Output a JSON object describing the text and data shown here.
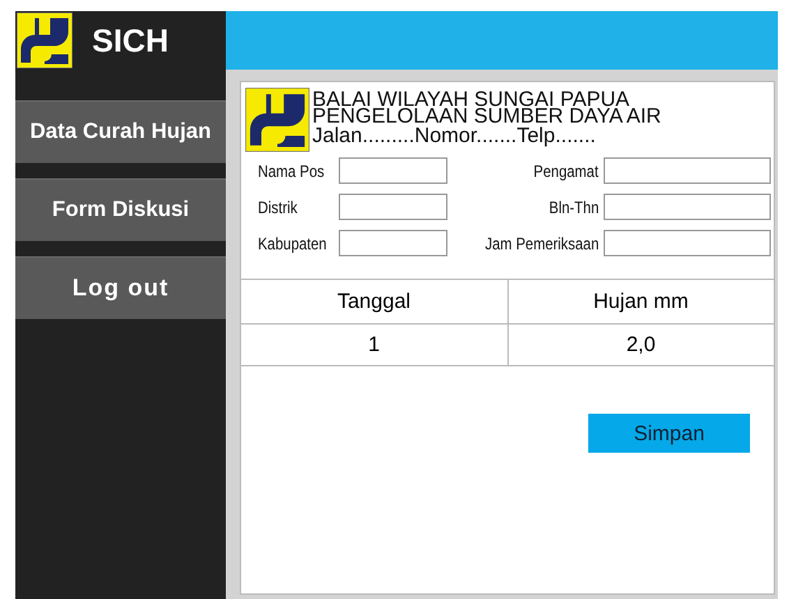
{
  "app": {
    "title": "SICH"
  },
  "sidebar": {
    "items": [
      {
        "label": "Data Curah Hujan",
        "selected": false
      },
      {
        "label": "Form Diskusi",
        "selected": false
      },
      {
        "label": "Log out",
        "selected": false
      }
    ]
  },
  "header": {
    "lines": [
      "BALAI WILAYAH SUNGAI PAPUA",
      "PENGELOLAAN SUMBER DAYA AIR",
      "Jalan.........Nomor.......Telp......."
    ]
  },
  "form": {
    "fields": [
      {
        "label": "Nama Pos"
      },
      {
        "label": "Pengamat"
      },
      {
        "label": "Distrik"
      },
      {
        "label": "Bln-Thn"
      },
      {
        "label": "Kabupaten"
      },
      {
        "label": "Jam Pemeriksaan"
      }
    ]
  },
  "table": {
    "columns": [
      "Tanggal",
      "Hujan mm"
    ],
    "rows": [
      [
        "1",
        "2,0"
      ]
    ]
  },
  "buttons": [
    "Simpan"
  ]
}
